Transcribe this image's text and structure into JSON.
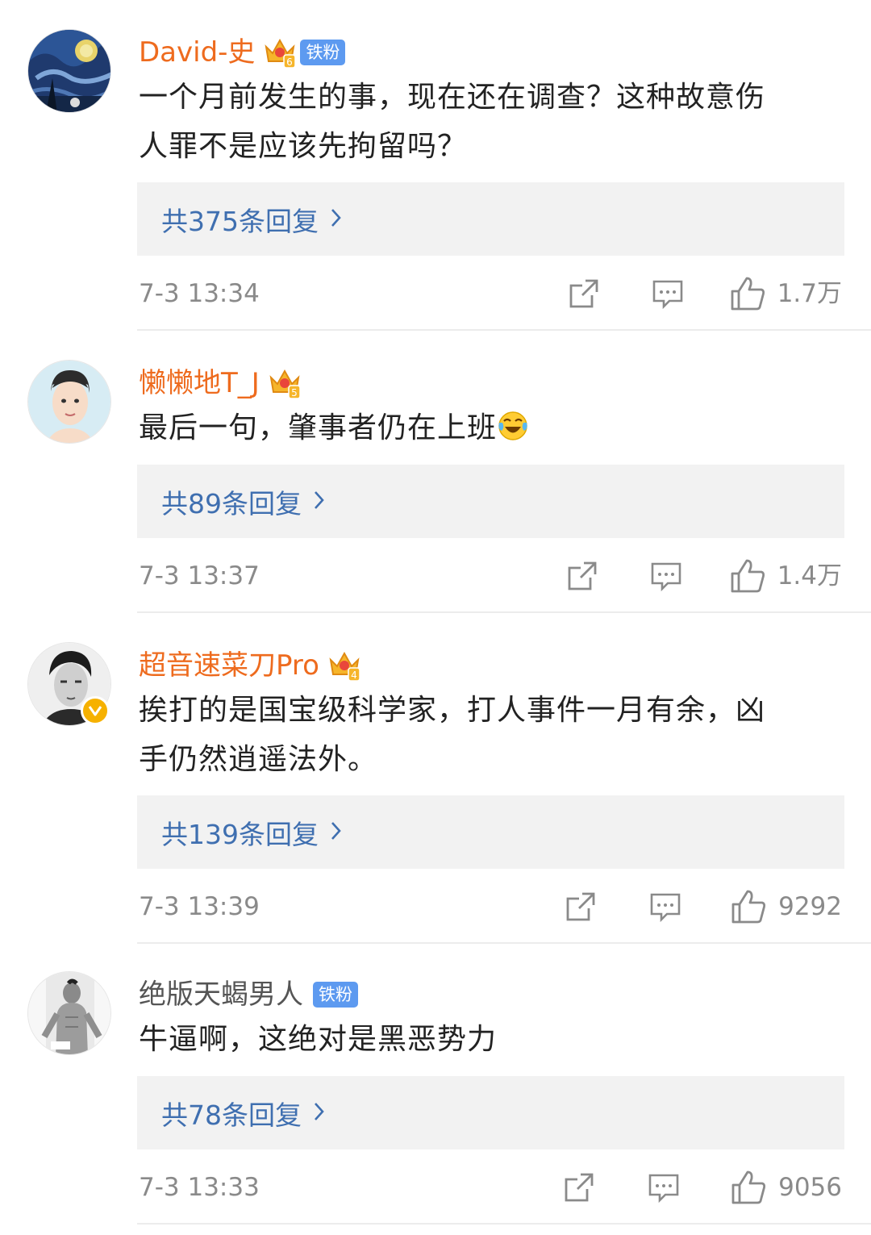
{
  "comments": [
    {
      "username": "David-史",
      "crown_level": "6",
      "fan_badge": "铁粉",
      "text_lines": [
        "一个月前发生的事，现在还在调查？这种故意伤",
        "人罪不是应该先拘留吗？"
      ],
      "replies": "共375条回复",
      "time": "7-3 13:34",
      "likes": "1.7万"
    },
    {
      "username": "懒懒地T_J",
      "crown_level": "5",
      "text_lines": [
        "最后一句，肇事者仍在上班"
      ],
      "emoji": "laughing-crying-emoji",
      "replies": "共89条回复",
      "time": "7-3 13:37",
      "likes": "1.4万"
    },
    {
      "username": "超音速菜刀Pro",
      "crown_level": "4",
      "verified": true,
      "text_lines": [
        "挨打的是国宝级科学家，打人事件一月有余，凶",
        "手仍然逍遥法外。"
      ],
      "replies": "共139条回复",
      "time": "7-3 13:39",
      "likes": "9292"
    },
    {
      "username": "绝版天蝎男人",
      "fan_badge": "铁粉",
      "text_lines": [
        "牛逼啊，这绝对是黑恶势力"
      ],
      "replies": "共78条回复",
      "time": "7-3 13:33",
      "likes": "9056"
    }
  ],
  "icons": {
    "reply_chevron": "chevron-right-icon",
    "share": "share-icon",
    "comment": "comment-icon",
    "like": "thumb-up-icon"
  },
  "colors": {
    "username_vip": "#ee6b1e",
    "link_blue": "#3f6fb0",
    "fan_badge": "#5d9af0",
    "reply_box": "#f2f2f2",
    "meta_gray": "#8a8a8a"
  }
}
